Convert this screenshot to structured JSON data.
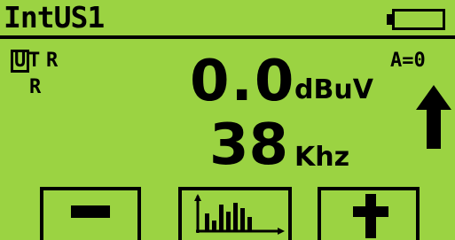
{
  "header": {
    "title": "IntUS1"
  },
  "status": {
    "u_label": "U",
    "t_label": "T",
    "r_label_top": "R",
    "r_label_bottom": "R",
    "alpha": "A=0"
  },
  "measurement": {
    "level_value": "0.0",
    "level_unit": "dBuV",
    "freq_value": "38",
    "freq_unit": "Khz"
  },
  "icons": {
    "battery": "battery-icon",
    "trend": "up-arrow-icon",
    "minus": "minus-icon",
    "spectrum": "spectrum-icon",
    "plus": "plus-icon"
  },
  "colors": {
    "lcd_background": "#9bd342",
    "ink": "#000000"
  }
}
